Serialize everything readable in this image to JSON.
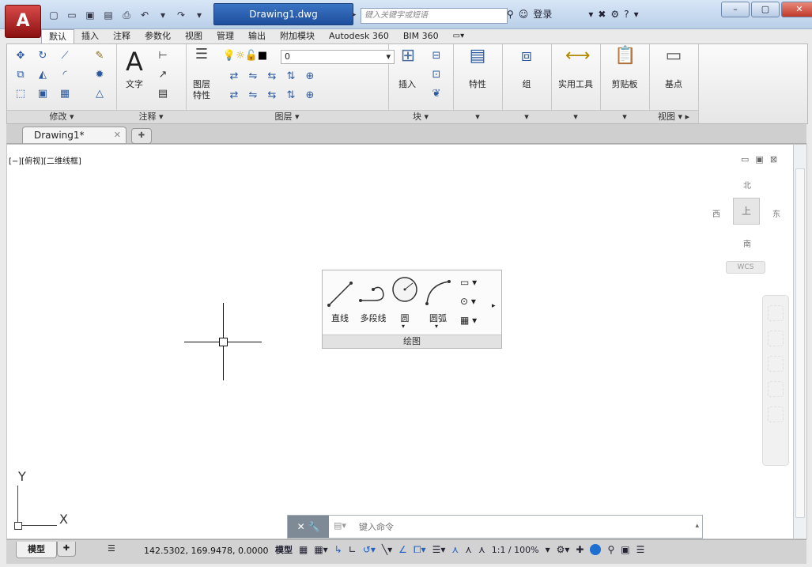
{
  "window": {
    "doc_title": "Drawing1.dwg",
    "app_button": "A",
    "app_button_icon": "autocad-logo-icon",
    "search_placeholder": "键入关键字或短语",
    "login": "登录"
  },
  "tabs": [
    {
      "label": "默认",
      "active": true
    },
    {
      "label": "插入"
    },
    {
      "label": "注释"
    },
    {
      "label": "参数化"
    },
    {
      "label": "视图"
    },
    {
      "label": "管理"
    },
    {
      "label": "输出"
    },
    {
      "label": "附加模块"
    },
    {
      "label": "Autodesk 360"
    },
    {
      "label": "BIM 360"
    }
  ],
  "ribbon": {
    "modify": {
      "title": "修改"
    },
    "annotation": {
      "title": "注释",
      "text_label": "文字"
    },
    "layers": {
      "title": "图层",
      "layer_properties_label_1": "图层",
      "layer_properties_label_2": "特性",
      "current_layer": "0"
    },
    "block": {
      "title": "块",
      "insert_label": "插入"
    },
    "properties": {
      "label": "特性"
    },
    "groups": {
      "label": "组"
    },
    "utilities": {
      "label": "实用工具"
    },
    "clipboard": {
      "label": "剪贴板"
    },
    "view": {
      "basepoint_label": "基点",
      "title": "视图"
    }
  },
  "file_tab": {
    "name": "Drawing1*"
  },
  "viewport": {
    "label": "[−][俯视][二维线框]",
    "compass": {
      "north": "北",
      "south": "南",
      "east": "东",
      "west": "西",
      "top": "上"
    },
    "wcs": "WCS"
  },
  "draw_panel": {
    "title": "绘图",
    "line_label": "直线",
    "polyline_label": "多段线",
    "circle_label": "圆",
    "arc_label": "圆弧"
  },
  "ucs": {
    "x": "X",
    "y": "Y"
  },
  "command_line": {
    "placeholder": "键入命令"
  },
  "status_bar": {
    "model_tab": "模型",
    "coordinates": "142.5302, 169.9478, 0.0000",
    "model_label": "模型",
    "scale": "1:1 / 100%"
  }
}
